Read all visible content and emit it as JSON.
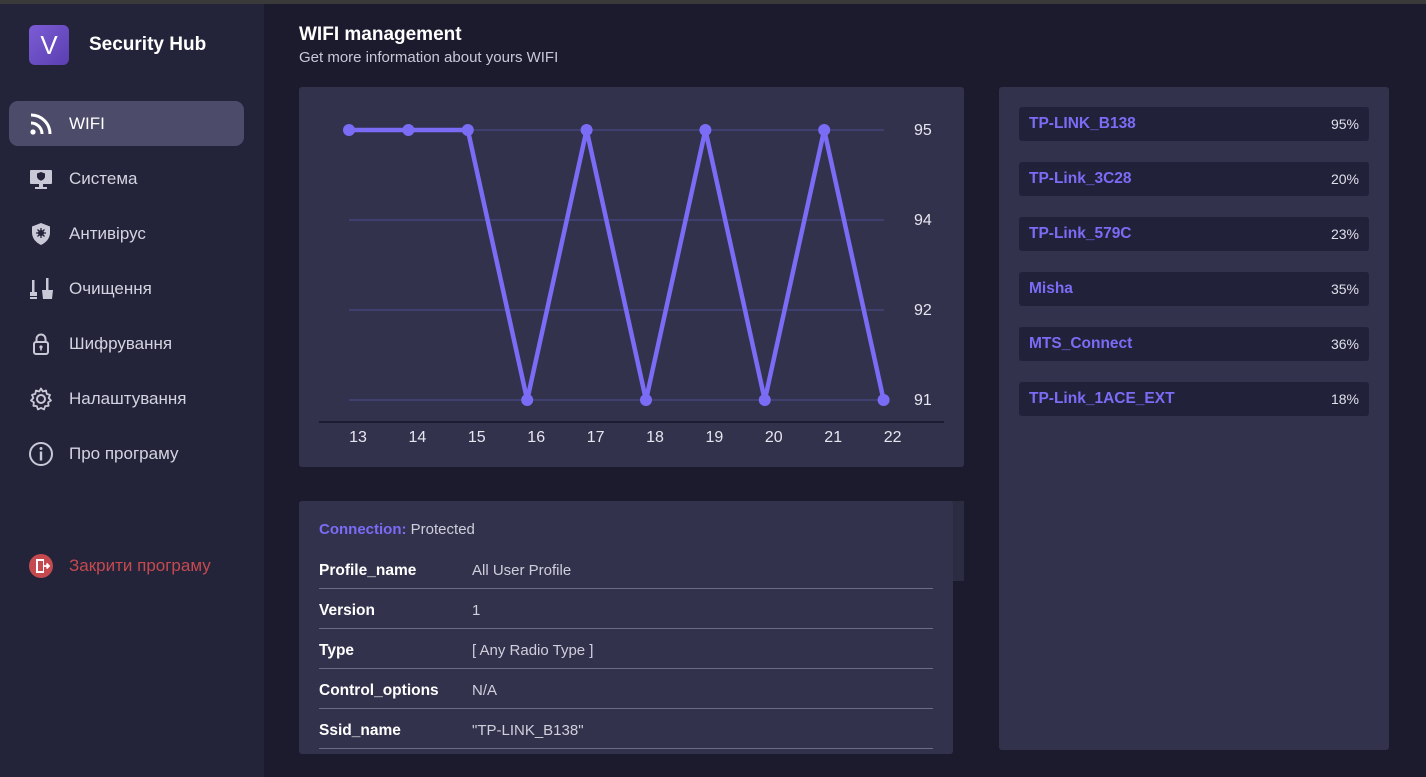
{
  "brand": {
    "logo_letter": "V",
    "name": "Security Hub"
  },
  "sidebar": {
    "items": [
      {
        "label": "WIFI",
        "icon": "wifi-icon",
        "active": true
      },
      {
        "label": "Система",
        "icon": "monitor-shield-icon"
      },
      {
        "label": "Антивірус",
        "icon": "antivirus-shield-icon"
      },
      {
        "label": "Очищення",
        "icon": "broom-icon"
      },
      {
        "label": "Шифрування",
        "icon": "lock-icon"
      },
      {
        "label": "Налаштування",
        "icon": "gear-icon"
      },
      {
        "label": "Про програму",
        "icon": "info-icon"
      }
    ],
    "exit": {
      "label": "Закрити програму",
      "icon": "exit-door-icon"
    }
  },
  "header": {
    "title": "WIFI management",
    "subtitle": "Get more information about yours WIFI"
  },
  "chart_data": {
    "type": "line",
    "x": [
      13,
      14,
      15,
      16,
      17,
      18,
      19,
      20,
      21,
      22
    ],
    "series": [
      {
        "values": [
          95,
          95,
          95,
          91,
          95,
          91,
          95,
          91,
          95,
          91
        ]
      }
    ],
    "y_ticks": [
      95,
      94,
      92,
      91
    ],
    "x_ticks": [
      "13",
      "14",
      "15",
      "16",
      "17",
      "18",
      "19",
      "20",
      "21",
      "22"
    ],
    "y_axis_position": "right",
    "grid": true,
    "title": "",
    "xlabel": "",
    "ylabel": "",
    "colors": {
      "line": "#7b6cf6",
      "grid": "#4a4a86"
    }
  },
  "info": {
    "connection_label": "Connection:",
    "connection_value": "Protected",
    "rows": [
      {
        "key": "Profile_name",
        "value": "All User Profile"
      },
      {
        "key": "Version",
        "value": "1"
      },
      {
        "key": "Type",
        "value": "[ Any Radio Type ]"
      },
      {
        "key": "Control_options",
        "value": "N/A"
      },
      {
        "key": "Ssid_name",
        "value": "\"TP-LINK_B138\""
      }
    ]
  },
  "networks": [
    {
      "name": "TP-LINK_B138",
      "signal": "95%"
    },
    {
      "name": "TP-Link_3C28",
      "signal": "20%"
    },
    {
      "name": "TP-Link_579C",
      "signal": "23%"
    },
    {
      "name": "Misha",
      "signal": "35%"
    },
    {
      "name": "MTS_Connect",
      "signal": "36%"
    },
    {
      "name": "TP-Link_1ACE_EXT",
      "signal": "18%"
    }
  ],
  "colors": {
    "background": "#1c1b2e",
    "sidebar": "#23233a",
    "panel": "#32324d",
    "accent": "#7b6cf6",
    "danger": "#c44a4f"
  }
}
